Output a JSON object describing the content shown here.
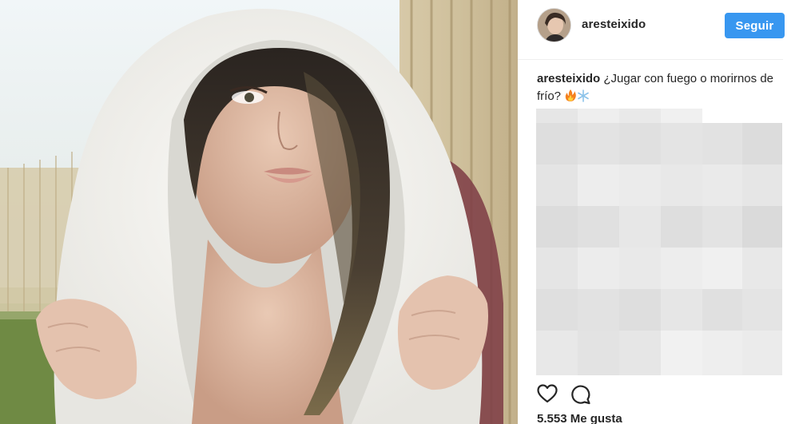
{
  "post": {
    "image_icon": "photo",
    "header": {
      "username": "aresteixido",
      "follow_label": "Seguir",
      "accent_color": "#3897f0"
    },
    "caption": {
      "username": "aresteixido",
      "text": "¿Jugar con fuego o morirnos de frío?",
      "emojis": [
        "fire-emoji",
        "snowflake-emoji"
      ]
    },
    "actions": {
      "like_icon": "heart-icon",
      "comment_icon": "comment-icon"
    },
    "likes_text": "5.553 Me gusta"
  }
}
